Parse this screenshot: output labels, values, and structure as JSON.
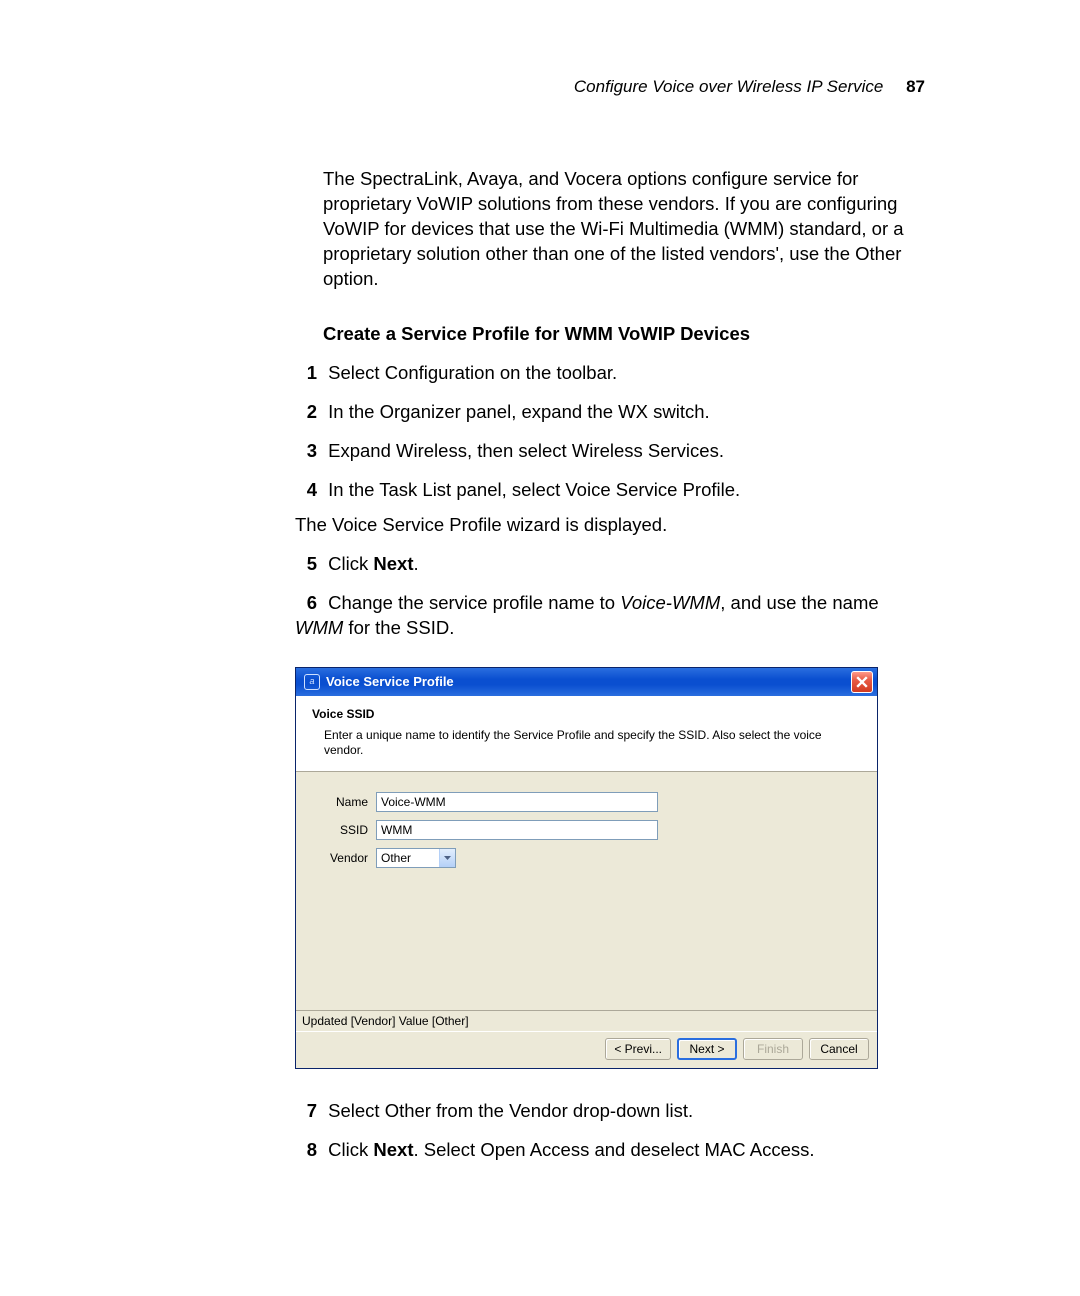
{
  "header": {
    "title": "Configure Voice over Wireless IP Service",
    "page_number": "87"
  },
  "intro_paragraph": "The SpectraLink, Avaya, and Vocera options configure service for proprietary VoWIP solutions from these vendors. If you are configuring VoWIP for devices that use the Wi-Fi Multimedia (WMM) standard, or a proprietary solution other than one of the listed vendors', use the Other option.",
  "section_heading": "Create a Service Profile for WMM VoWIP Devices",
  "steps": [
    {
      "num": "1",
      "text": "Select Configuration on the toolbar."
    },
    {
      "num": "2",
      "text": "In the Organizer panel, expand the WX switch."
    },
    {
      "num": "3",
      "text": "Expand Wireless, then select Wireless Services."
    },
    {
      "num": "4",
      "text": "In the Task List panel, select Voice Service Profile.",
      "sub": "The Voice Service Profile wizard is displayed."
    },
    {
      "num": "5",
      "pre": "Click ",
      "bold": "Next",
      "post": "."
    },
    {
      "num": "6",
      "pre": "Change the service profile name to ",
      "italic1": "Voice-WMM",
      "mid": ", and use the name ",
      "italic2": "WMM",
      "post": " for the SSID."
    }
  ],
  "steps_after": [
    {
      "num": "7",
      "text": "Select Other from the Vendor drop-down list."
    },
    {
      "num": "8",
      "pre": "Click ",
      "bold": "Next",
      "post": ". Select Open Access and deselect MAC Access."
    }
  ],
  "wizard": {
    "title": "Voice Service Profile",
    "heading": "Voice SSID",
    "subheading": "Enter a unique name to identify the Service Profile and specify the SSID. Also select the voice vendor.",
    "fields": {
      "name_label": "Name",
      "name_value": "Voice-WMM",
      "ssid_label": "SSID",
      "ssid_value": "WMM",
      "vendor_label": "Vendor",
      "vendor_value": "Other"
    },
    "status": "Updated [Vendor] Value [Other]",
    "buttons": {
      "prev": "< Previ...",
      "next": "Next >",
      "finish": "Finish",
      "cancel": "Cancel"
    }
  }
}
